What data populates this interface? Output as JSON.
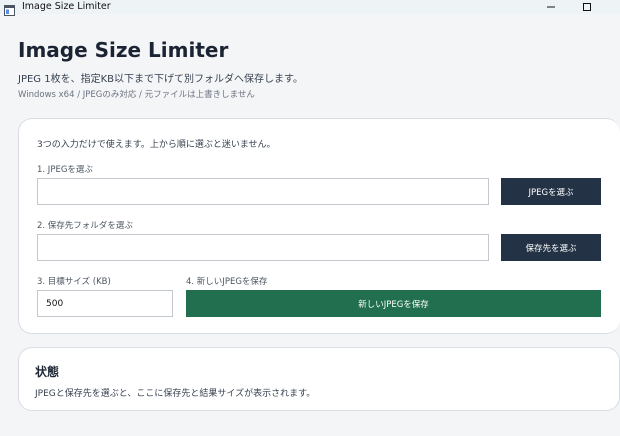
{
  "window": {
    "title": "Image Size Limiter",
    "icon": "app-window-icon"
  },
  "header": {
    "title": "Image Size Limiter",
    "subtitle": "JPEG 1枚を、指定KB以下まで下げて別フォルダへ保存します。",
    "note": "Windows x64 / JPEGのみ対応 / 元ファイルは上書きしません"
  },
  "form": {
    "instructions": "3つの入力だけで使えます。上から順に選ぶと迷いません。",
    "jpeg": {
      "label": "1. JPEGを選ぶ",
      "value": "",
      "button_label": "JPEGを選ぶ"
    },
    "folder": {
      "label": "2. 保存先フォルダを選ぶ",
      "value": "",
      "button_label": "保存先を選ぶ"
    },
    "target_size": {
      "label": "3. 目標サイズ (KB)",
      "value": "500"
    },
    "save": {
      "label": "4. 新しいJPEGを保存",
      "button_label": "新しいJPEGを保存"
    }
  },
  "status": {
    "title": "状態",
    "text": "JPEGと保存先を選ぶと、ここに保存先と結果サイズが表示されます。"
  },
  "colors": {
    "background": "#f4f5f7",
    "dark_button": "#243246",
    "save_button": "#216f4f"
  }
}
